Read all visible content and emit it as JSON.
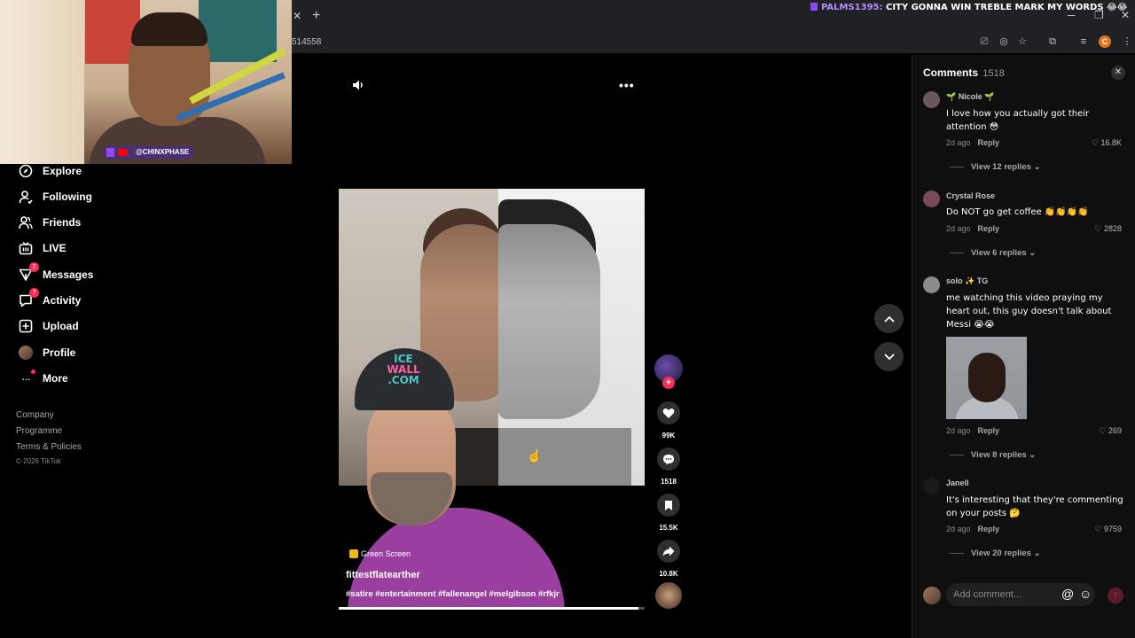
{
  "browser": {
    "url_fragment": "514558",
    "stream_chat": {
      "user": "PALMS1395:",
      "message": "CITY GONNA WIN TREBLE MARK MY WORDS",
      "emoji": "😂😂"
    },
    "profile_initial": "C"
  },
  "webcam": {
    "tag": "@CHINXPHASE"
  },
  "sidebar": {
    "items": [
      {
        "label": "Explore",
        "icon": "compass-icon"
      },
      {
        "label": "Following",
        "icon": "user-follow-icon"
      },
      {
        "label": "Friends",
        "icon": "friends-icon"
      },
      {
        "label": "LIVE",
        "icon": "live-icon"
      },
      {
        "label": "Messages",
        "icon": "inbox-icon",
        "badge": "2"
      },
      {
        "label": "Activity",
        "icon": "activity-icon",
        "badge": "7"
      },
      {
        "label": "Upload",
        "icon": "upload-icon"
      },
      {
        "label": "Profile",
        "icon": "avatar-icon"
      },
      {
        "label": "More",
        "icon": "more-icon"
      }
    ],
    "footer": [
      "Company",
      "Programme",
      "Terms & Policies"
    ],
    "copyright": "© 2026 TikTok"
  },
  "video": {
    "cap_text": [
      "ICE",
      "WALL",
      ".COM"
    ],
    "effect": "Green Screen",
    "author": "fittestflatearther",
    "tags": "#satire #entertainment #fallenangel #melgibson #rfkjr",
    "progress": 0.98
  },
  "actions": {
    "likes": "99K",
    "comments": "1518",
    "saves": "15.5K",
    "shares": "10.8K"
  },
  "comments": {
    "title": "Comments",
    "count": "1518",
    "items": [
      {
        "user": "🌱 Nicole 🌱",
        "text": "I love how you actually got their attention 😳",
        "time": "2d ago",
        "reply": "Reply",
        "likes": "16.8K",
        "view": "View 12 replies",
        "avatar_color": "#6b5560"
      },
      {
        "user": "Crystal Rose",
        "text": "Do NOT go get coffee 👏👏👏👏",
        "time": "2d ago",
        "reply": "Reply",
        "likes": "2828",
        "view": "View 6 replies",
        "avatar_color": "#7a4a5a"
      },
      {
        "user": "solo ✨ TG",
        "text": "me watching this video praying my heart out, this guy doesn't talk about Messi 😭😭",
        "time": "2d ago",
        "reply": "Reply",
        "likes": "269",
        "view": "View 8 replies",
        "avatar_color": "#8a8a8a"
      },
      {
        "user": "Janell",
        "text": "It's interesting that they're commenting on your posts 🤔",
        "time": "2d ago",
        "reply": "Reply",
        "likes": "9759",
        "view": "View 20 replies",
        "avatar_color": "#1a1a1a"
      }
    ],
    "input_placeholder": "Add comment..."
  },
  "colors": {
    "accent": "#fe2c55",
    "panel": "#0f0f10",
    "twitch": "#9146ff"
  }
}
